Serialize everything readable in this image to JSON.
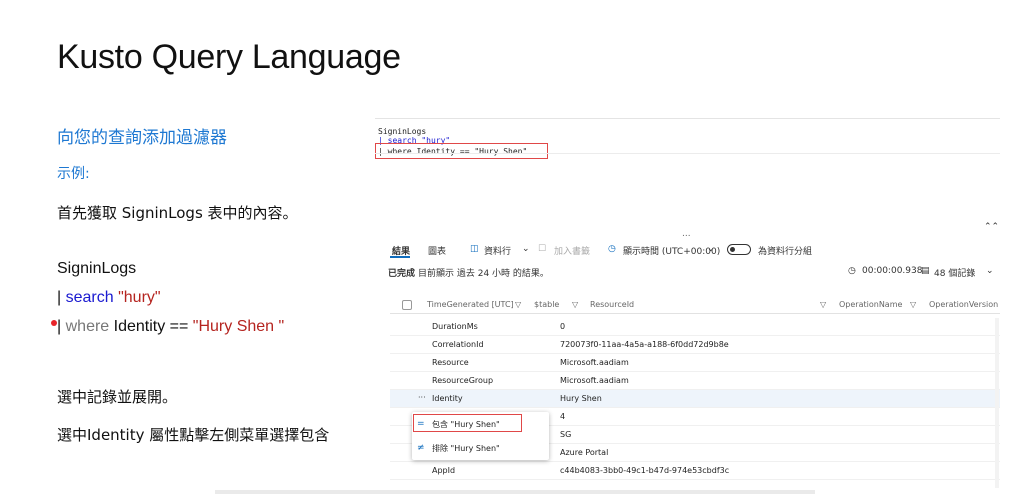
{
  "slide": {
    "title": "Kusto Query Language",
    "heading": "向您的查詢添加過濾器",
    "example_label": "示例:",
    "intro": "首先獲取 SigninLogs 表中的內容。",
    "code": {
      "line1": "SigninLogs",
      "line2_pipe": "| ",
      "line2_kw": "search",
      "line2_str": "\"hury\"",
      "line3_pipe": "| ",
      "line3_kw": "where",
      "line3_mid": " Identity == ",
      "line3_str": "\"Hury Shen \""
    },
    "step2": "選中記錄並展開。",
    "step3": "選中Identity 屬性點擊左側菜單選擇包含"
  },
  "editor": {
    "line1": "SigninLogs",
    "line2": "| search \"hury\"",
    "line3": "| where Identity == \"Hury Shen\"",
    "collapse_icon": "double-chevron-up-icon",
    "splitter": "..."
  },
  "toolbar": {
    "tab_results": "結果",
    "tab_chart": "圖表",
    "columns_label": "資料行",
    "add_bookmark": "加入書籤",
    "time_display": "顯示時間 (UTC+00:00)",
    "group_by_columns": "為資料行分組"
  },
  "status": {
    "completed": "已完成",
    "summary": "目前顯示 過去 24 小時 的結果。",
    "duration": "00:00:00.938",
    "record_count": "48 個記錄"
  },
  "grid": {
    "headers": [
      "TimeGenerated [UTC]",
      "$table",
      "ResourceId",
      "OperationName",
      "OperationVersion"
    ],
    "rows": [
      {
        "key": "DurationMs",
        "value": "0"
      },
      {
        "key": "CorrelationId",
        "value": "720073f0-11aa-4a5a-a188-6f0dd72d9b8e"
      },
      {
        "key": "Resource",
        "value": "Microsoft.aadiam"
      },
      {
        "key": "ResourceGroup",
        "value": "Microsoft.aadiam"
      },
      {
        "key": "Identity",
        "value": "Hury Shen"
      },
      {
        "key": "",
        "value": "4"
      },
      {
        "key": "",
        "value": "SG"
      },
      {
        "key": "",
        "value": "Azure Portal"
      },
      {
        "key": "AppId",
        "value": "c44b4083-3bb0-49c1-b47d-974e53cbdf3c"
      }
    ]
  },
  "context_menu": {
    "include": "包含 \"Hury Shen\"",
    "exclude": "排除 \"Hury Shen\""
  },
  "colors": {
    "accent_blue": "#1e78d2",
    "highlight_red": "#e04848"
  }
}
